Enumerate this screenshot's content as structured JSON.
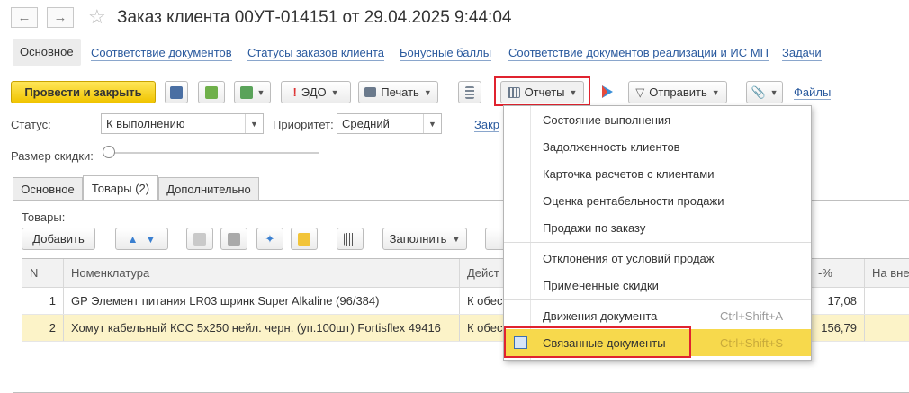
{
  "window": {
    "title": "Заказ клиента 00УТ-014151 от 29.04.2025 9:44:04"
  },
  "nav_tabs": [
    {
      "label": "Основное"
    },
    {
      "label": "Соответствие документов"
    },
    {
      "label": "Статусы заказов клиента"
    },
    {
      "label": "Бонусные баллы"
    },
    {
      "label": "Соответствие документов реализации и ИС МП"
    },
    {
      "label": "Задачи"
    }
  ],
  "toolbar": {
    "post_close": "Провести и закрыть",
    "edo": "ЭДО",
    "print": "Печать",
    "reports": "Отчеты",
    "send": "Отправить",
    "files": "Файлы"
  },
  "form": {
    "status_label": "Статус:",
    "status_value": "К выполнению",
    "priority_label": "Приоритет:",
    "priority_value": "Средний",
    "link_cut": "Закр",
    "discount_label": "Размер скидки:",
    "discount_level": 0.0
  },
  "section_tabs": [
    {
      "label": "Основное"
    },
    {
      "label": "Товары (2)"
    },
    {
      "label": "Дополнительно"
    }
  ],
  "goods": {
    "label": "Товары:",
    "add": "Добавить",
    "fill": "Заполнить"
  },
  "table": {
    "headers": [
      "N",
      "Номенклатура",
      "Дейст",
      "-%",
      "На внеш"
    ],
    "rows": [
      {
        "n": "1",
        "name": "GP Элемент питания LR03 шринк Super Alkaline (96/384)",
        "action": "К обес",
        "pct": "17,08",
        "sel": false
      },
      {
        "n": "2",
        "name": "Хомут кабельный КСС 5х250 нейл. черн. (уп.100шт) Fortisflex 49416",
        "action": "К обес",
        "pct": "156,79",
        "sel": true
      }
    ]
  },
  "reports_menu": {
    "items": [
      {
        "label": "Состояние выполнения",
        "shortcut": ""
      },
      {
        "label": "Задолженность клиентов",
        "shortcut": ""
      },
      {
        "label": "Карточка расчетов с клиентами",
        "shortcut": ""
      },
      {
        "label": "Оценка рентабельности продажи",
        "shortcut": ""
      },
      {
        "label": "Продажи по заказу",
        "shortcut": ""
      },
      {
        "label": "Отклонения от условий продаж",
        "shortcut": ""
      },
      {
        "label": "Примененные скидки",
        "shortcut": ""
      },
      {
        "label": "Движения документа",
        "shortcut": "Ctrl+Shift+A"
      },
      {
        "label": "Связанные документы",
        "shortcut": "Ctrl+Shift+S"
      }
    ]
  },
  "colors": {
    "accent_yellow": "#f7d94c",
    "highlight_red": "#e0232f",
    "link_blue": "#2a5a9e"
  }
}
